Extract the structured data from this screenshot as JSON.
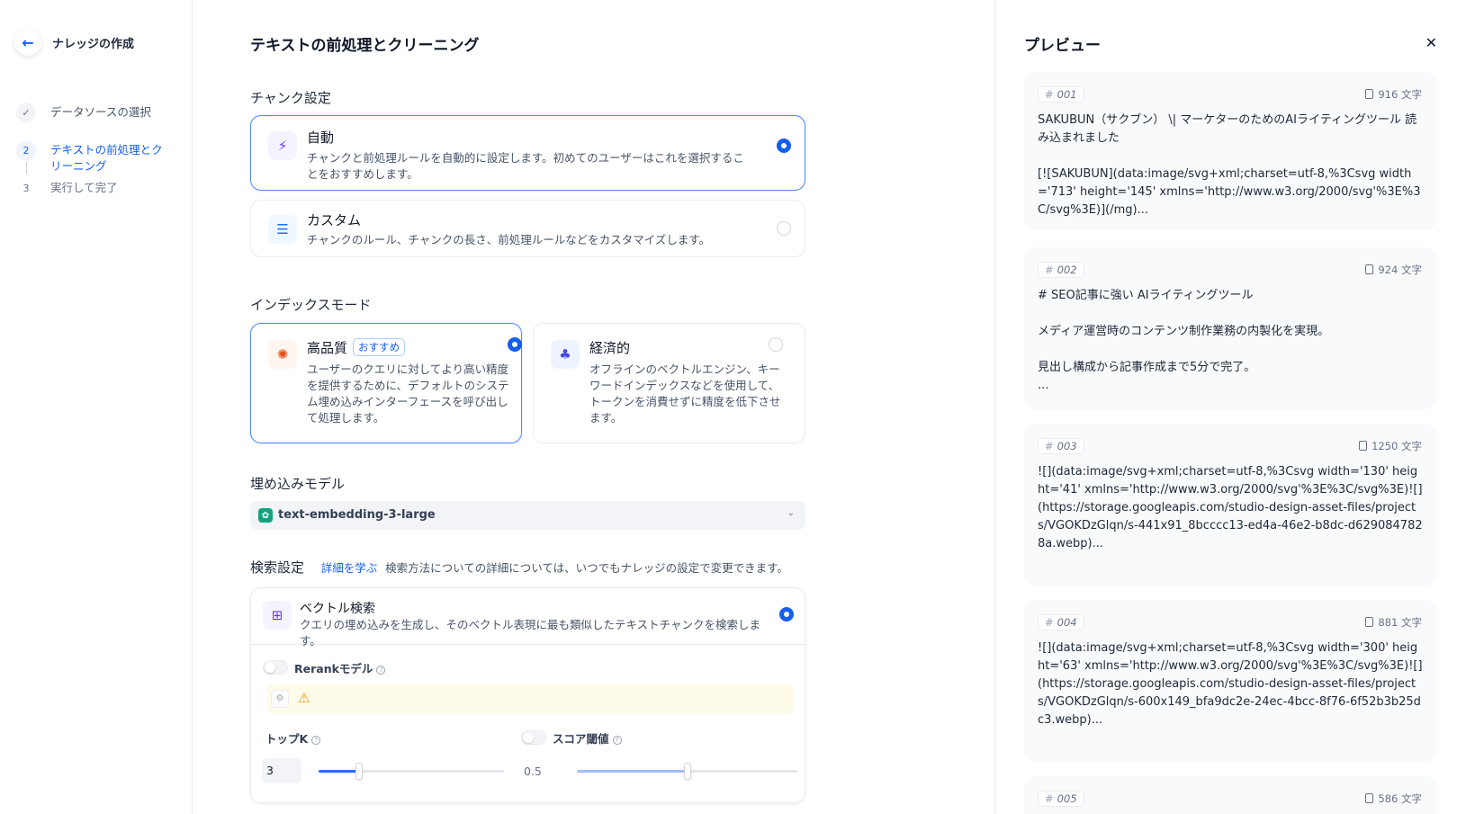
{
  "sidebar": {
    "title": "ナレッジの作成",
    "steps": [
      {
        "number": "✓",
        "label": "データソースの選択"
      },
      {
        "number": "2",
        "label": "テキストの前処理とクリーニング"
      },
      {
        "number": "3",
        "label": "実行して完了"
      }
    ]
  },
  "main": {
    "title": "テキストの前処理とクリーニング",
    "chunk": {
      "section_title": "チャンク設定",
      "auto": {
        "title": "自動",
        "desc": "チャンクと前処理ルールを自動的に設定します。初めてのユーザーはこれを選択することをおすすめします。"
      },
      "custom": {
        "title": "カスタム",
        "desc": "チャンクのルール、チャンクの長さ、前処理ルールなどをカスタマイズします。"
      }
    },
    "index": {
      "section_title": "インデックスモード",
      "high": {
        "title": "高品質",
        "badge": "おすすめ",
        "desc": "ユーザーのクエリに対してより高い精度を提供するために、デフォルトのシステム埋め込みインターフェースを呼び出して処理します。"
      },
      "economy": {
        "title": "経済的",
        "desc": "オフラインのベクトルエンジン、キーワードインデックスなどを使用して、トークンを消費せずに精度を低下させます。"
      }
    },
    "embedding": {
      "section_title": "埋め込みモデル",
      "value": "text-embedding-3-large"
    },
    "search": {
      "section_title": "検索設定",
      "learn_more": "詳細を学ぶ",
      "hint": "検索方法についての詳細については、いつでもナレッジの設定で変更できます。",
      "vector": {
        "title": "ベクトル検索",
        "desc": "クエリの埋め込みを生成し、そのベクトル表現に最も類似したテキストチャンクを検索します。"
      },
      "rerank_label": "Rerankモデル",
      "topk_label": "トップK",
      "topk_value": "3",
      "topk_fraction": 0.22,
      "score_label": "スコア閾値",
      "score_value": "0.5",
      "score_fraction": 0.5
    }
  },
  "preview": {
    "title": "プレビュー",
    "chunks": [
      {
        "id": "001",
        "count": "916 文字",
        "text": "SAKUBUN（サクブン） \\| マーケターのためのAIライティングツール 読み込まれました\n\n[![SAKUBUN](data:image/svg+xml;charset=utf-8,%3Csvg width='713' height='145' xmlns='http://www.w3.org/2000/svg'%3E%3C/svg%3E)](/mg)..."
      },
      {
        "id": "002",
        "count": "924 文字",
        "text": "# SEO記事に強い AIライティングツール\n\nメディア運営時のコンテンツ制作業務の内製化を実現。\n\n見出し構成から記事作成まで5分で完了。\n..."
      },
      {
        "id": "003",
        "count": "1250 文字",
        "text": "![](data:image/svg+xml;charset=utf-8,%3Csvg width='130' height='41' xmlns='http://www.w3.org/2000/svg'%3E%3C/svg%3E)![](https://storage.googleapis.com/studio-design-asset-files/projects/VGOKDzGlqn/s-441x91_8bcccc13-ed4a-46e2-b8dc-d6290847828a.webp)..."
      },
      {
        "id": "004",
        "count": "881 文字",
        "text": "![](data:image/svg+xml;charset=utf-8,%3Csvg width='300' height='63' xmlns='http://www.w3.org/2000/svg'%3E%3C/svg%3E)![](https://storage.googleapis.com/studio-design-asset-files/projects/VGOKDzGlqn/s-600x149_bfa9dc2e-24ec-4bcc-8f76-6f52b3b25dc3.webp)..."
      },
      {
        "id": "005",
        "count": "586 文字",
        "text": ""
      }
    ]
  },
  "colors": {
    "accent": "#155eef",
    "border": "#eaecf0",
    "chunk_bg": "#f9fafb"
  }
}
